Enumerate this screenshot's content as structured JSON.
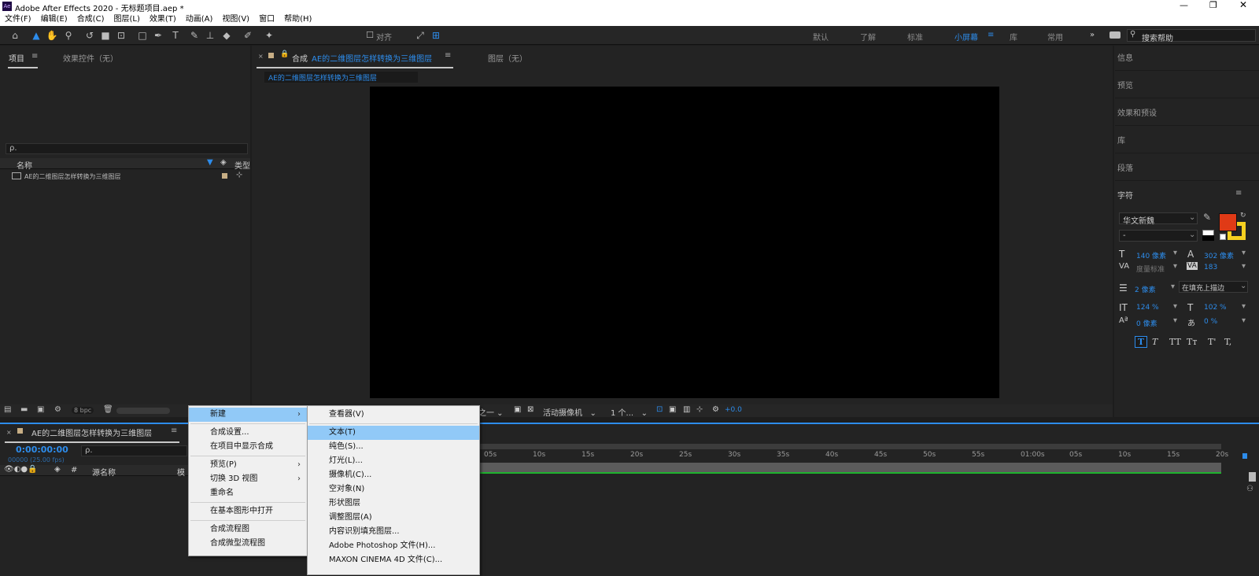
{
  "window": {
    "title": "Adobe After Effects 2020 - 无标题项目.aep *",
    "app_icon": "Ae"
  },
  "menubar": [
    "文件(F)",
    "编辑(E)",
    "合成(C)",
    "图层(L)",
    "效果(T)",
    "动画(A)",
    "视图(V)",
    "窗口",
    "帮助(H)"
  ],
  "toolbar": {
    "align_label": "对齐",
    "workspaces": [
      "默认",
      "了解",
      "标准",
      "小屏幕",
      "库",
      "常用"
    ],
    "active_workspace": "小屏幕",
    "search_placeholder": "搜索帮助"
  },
  "project_panel": {
    "tabs": [
      "项目",
      "效果控件（无）"
    ],
    "search_placeholder": "ρ.",
    "columns": {
      "name": "名称",
      "type": "类型"
    },
    "items": [
      {
        "name": "AE的二维图层怎样转换为三维图层"
      }
    ],
    "bpc": "8 bpc"
  },
  "comp_panel": {
    "tab_label": "合成",
    "comp_name": "AE的二维图层怎样转换为三维图层",
    "layer_tab": "图层（无）",
    "breadcrumb": "AE的二维图层怎样转换为三维图层",
    "res_label": "分之一",
    "camera": "活动摄像机",
    "views": "1 个...",
    "exposure": "+0.0"
  },
  "timeline": {
    "tab_label": "AE的二维图层怎样转换为三维图层",
    "timecode": "0:00:00:00",
    "fps": "00000 (25.00 fps)",
    "search_placeholder": "ρ.",
    "col_source": "源名称",
    "col_mode": "模",
    "col_hash": "#",
    "ticks": [
      "05s",
      "10s",
      "15s",
      "20s",
      "25s",
      "30s",
      "35s",
      "40s",
      "45s",
      "50s",
      "55s",
      "01:00s",
      "05s",
      "10s",
      "15s",
      "20s"
    ],
    "accent": "#2d8ceb",
    "bar_color": "#1fb22e"
  },
  "right_panel": {
    "sections": [
      "信息",
      "预览",
      "效果和预设",
      "库",
      "段落"
    ],
    "character_title": "字符",
    "font_family": "华文新魏",
    "font_style": "-",
    "font_size": "140 像素",
    "leading": "302 像素",
    "kerning": "度量标准",
    "tracking": "183",
    "stroke_width": "2 像素",
    "stroke_type": "在填充上描边",
    "vscale": "124 %",
    "hscale": "102 %",
    "baseline": "0 像素",
    "tsume": "0 %",
    "style_buttons": [
      "T",
      "T",
      "TT",
      "Tт",
      "T'",
      "T,"
    ],
    "fill_color": "#e03a16",
    "stroke_color": "#f5d020"
  },
  "context_menu": {
    "items": [
      "新建",
      "合成设置...",
      "在项目中显示合成",
      "预览(P)",
      "切换 3D 视图",
      "重命名",
      "在基本图形中打开",
      "合成流程图",
      "合成微型流程图"
    ],
    "highlighted": "新建"
  },
  "submenu": {
    "items": [
      "查看器(V)",
      "文本(T)",
      "纯色(S)...",
      "灯光(L)...",
      "摄像机(C)...",
      "空对象(N)",
      "形状图层",
      "调整图层(A)",
      "内容识别填充图层...",
      "Adobe Photoshop 文件(H)...",
      "MAXON CINEMA 4D 文件(C)..."
    ],
    "highlighted": "文本(T)"
  }
}
